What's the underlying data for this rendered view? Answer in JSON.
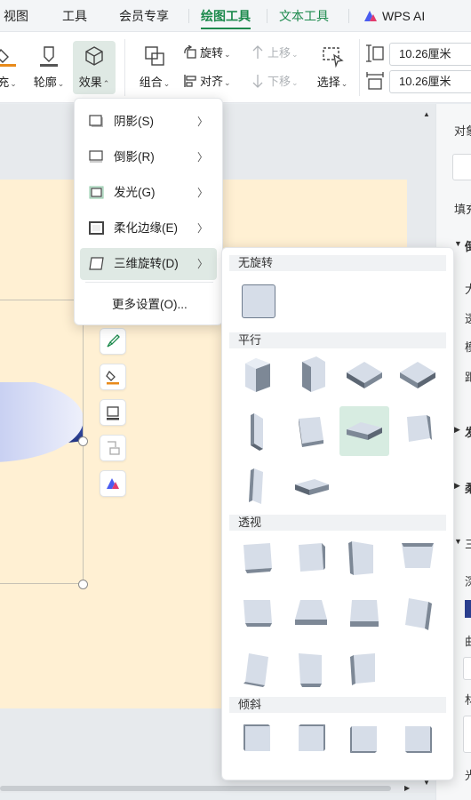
{
  "tabs": [
    {
      "label": "视图"
    },
    {
      "label": "工具"
    },
    {
      "label": "会员专享"
    },
    {
      "label": "绘图工具"
    },
    {
      "label": "文本工具"
    },
    {
      "label": "WPS AI"
    }
  ],
  "ribbon": {
    "fill_label": "充",
    "outline_label": "轮廓",
    "effect_label": "效果",
    "group_label": "组合",
    "rotate_label": "旋转",
    "align_label": "对齐",
    "up_label": "上移",
    "down_label": "下移",
    "select_label": "选择",
    "height_value": "10.26厘米",
    "width_value": "10.26厘米"
  },
  "effect_menu": {
    "items": [
      {
        "label": "阴影(S)",
        "icon": "shadow-square-icon"
      },
      {
        "label": "倒影(R)",
        "icon": "reflection-square-icon"
      },
      {
        "label": "发光(G)",
        "icon": "glow-square-icon"
      },
      {
        "label": "柔化边缘(E)",
        "icon": "soft-edge-square-icon"
      },
      {
        "label": "三维旋转(D)",
        "icon": "3d-rotation-icon"
      }
    ],
    "more_label": "更多设置(O)..."
  },
  "rotation_gallery": {
    "sections": [
      {
        "title": "无旋转"
      },
      {
        "title": "平行"
      },
      {
        "title": "透视"
      },
      {
        "title": "倾斜"
      }
    ]
  },
  "right_panel": {
    "obj_label": "对象",
    "fill_label": "填充",
    "shadow_label": "倒",
    "size_label": "大",
    "trans_label": "透",
    "blur_label": "模",
    "dist_label": "距",
    "glow_label": "发",
    "soft_label": "柔",
    "three_label": "三",
    "depth_label": "深",
    "curve_label": "曲",
    "material_label": "材",
    "light_label": "光"
  },
  "colors": {
    "accent": "#1d8a4d",
    "slide_bg": "#fff0d3",
    "shape_blue": "#2b3f8e",
    "selected_cell": "#d7ece1"
  }
}
